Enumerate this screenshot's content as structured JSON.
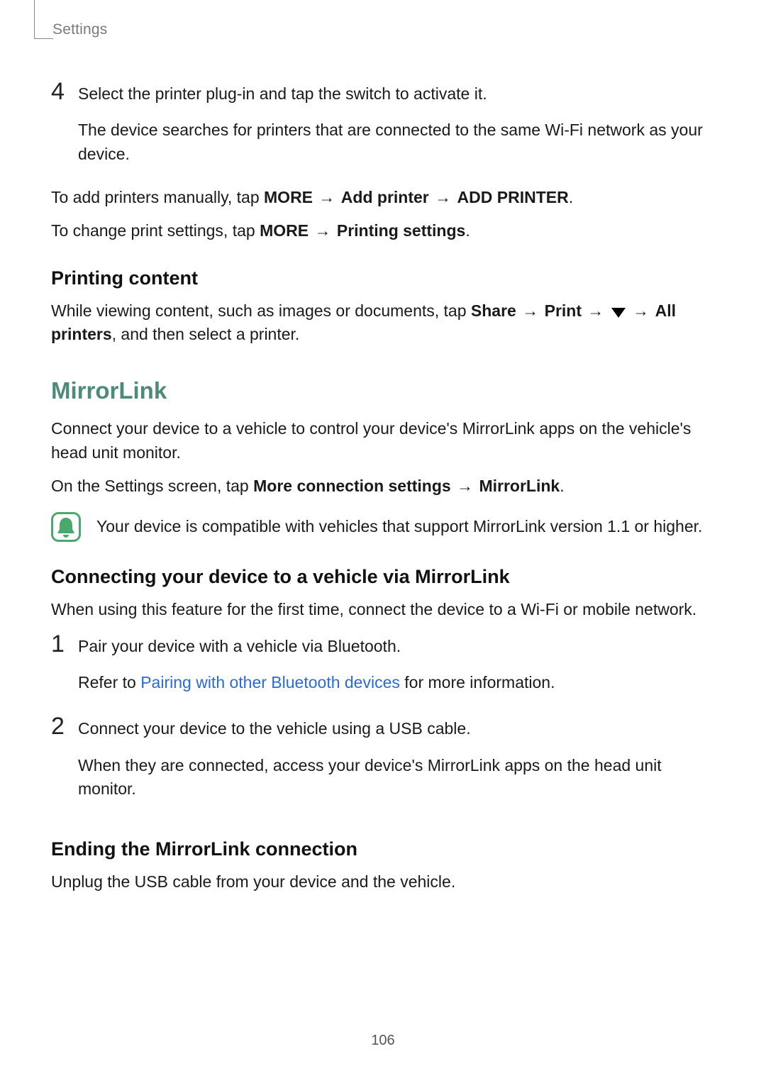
{
  "header": {
    "section_label": "Settings"
  },
  "step4": {
    "num": "4",
    "line1": "Select the printer plug-in and tap the switch to activate it.",
    "line2": "The device searches for printers that are connected to the same Wi-Fi network as your device."
  },
  "add_printers": {
    "prefix": "To add printers manually, tap ",
    "b1": "MORE",
    "arrow1": " → ",
    "b2": "Add printer",
    "arrow2": " → ",
    "b3": "ADD PRINTER",
    "suffix": "."
  },
  "change_settings": {
    "prefix": "To change print settings, tap ",
    "b1": "MORE",
    "arrow1": " → ",
    "b2": "Printing settings",
    "suffix": "."
  },
  "printing_content_heading": "Printing content",
  "printing_content_para": {
    "prefix": "While viewing content, such as images or documents, tap ",
    "b1": "Share",
    "arrow1": " → ",
    "b2": "Print",
    "arrow2": " → ",
    "arrow3": " → ",
    "b3": "All printers",
    "suffix": ", and then select a printer."
  },
  "mirrorlink_heading": "MirrorLink",
  "mirrorlink_intro": "Connect your device to a vehicle to control your device's MirrorLink apps on the vehicle's head unit monitor.",
  "mirrorlink_path": {
    "prefix": "On the Settings screen, tap ",
    "b1": "More connection settings",
    "arrow1": " → ",
    "b2": "MirrorLink",
    "suffix": "."
  },
  "note_text": "Your device is compatible with vehicles that support MirrorLink version 1.1 or higher.",
  "connecting_heading": "Connecting your device to a vehicle via MirrorLink",
  "connecting_intro": "When using this feature for the first time, connect the device to a Wi-Fi or mobile network.",
  "step1": {
    "num": "1",
    "line1": "Pair your device with a vehicle via Bluetooth.",
    "refer_prefix": "Refer to ",
    "refer_link": "Pairing with other Bluetooth devices",
    "refer_suffix": " for more information."
  },
  "step2": {
    "num": "2",
    "line1": "Connect your device to the vehicle using a USB cable.",
    "line2": "When they are connected, access your device's MirrorLink apps on the head unit monitor."
  },
  "ending_heading": "Ending the MirrorLink connection",
  "ending_body": "Unplug the USB cable from your device and the vehicle.",
  "page_number": "106"
}
